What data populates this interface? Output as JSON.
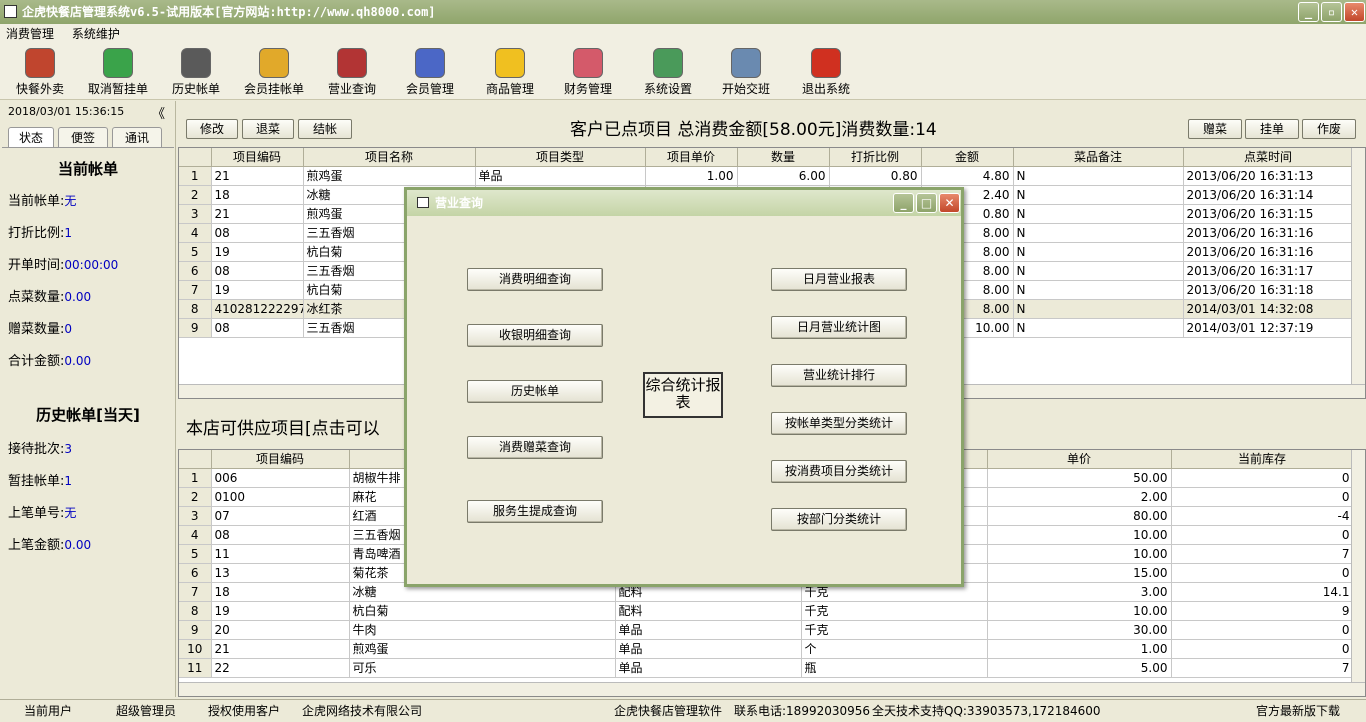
{
  "window": {
    "title": "企虎快餐店管理系统v6.5-试用版本[官方网站:http://www.qh8000.com]"
  },
  "menu": [
    "消费管理",
    "系统维护"
  ],
  "toolbar": [
    {
      "label": "快餐外卖",
      "icon": "takeout-icon",
      "color": "#c0452e"
    },
    {
      "label": "取消暂挂单",
      "icon": "cancel-hold-icon",
      "color": "#3aa34a"
    },
    {
      "label": "历史帐单",
      "icon": "alarm-clock-icon",
      "color": "#5a5a5a"
    },
    {
      "label": "会员挂帐单",
      "icon": "coins-arrow-icon",
      "color": "#e1a92a"
    },
    {
      "label": "营业查询",
      "icon": "report-icon",
      "color": "#b23434"
    },
    {
      "label": "会员管理",
      "icon": "member-face-icon",
      "color": "#4b67c6"
    },
    {
      "label": "商品管理",
      "icon": "star-icon",
      "color": "#f0c020"
    },
    {
      "label": "财务管理",
      "icon": "calculator-icon",
      "color": "#d45a6a"
    },
    {
      "label": "系统设置",
      "icon": "settings-icon",
      "color": "#4a9a5a"
    },
    {
      "label": "开始交班",
      "icon": "handshake-icon",
      "color": "#6a8ab0"
    },
    {
      "label": "退出系统",
      "icon": "power-icon",
      "color": "#d03020"
    }
  ],
  "left": {
    "datetime": "2018/03/01 15:36:15",
    "collapse": "《",
    "tabs": [
      "状态",
      "便签",
      "通讯"
    ],
    "current_title": "当前帐单",
    "current_fields": [
      {
        "label": "当前帐单:",
        "value": "无"
      },
      {
        "label": "打折比例:",
        "value": "1"
      },
      {
        "label": "开单时间:",
        "value": "00:00:00"
      },
      {
        "label": "点菜数量:",
        "value": "0.00"
      },
      {
        "label": "赠菜数量:",
        "value": "0"
      },
      {
        "label": "合计金额:",
        "value": "0.00"
      }
    ],
    "history_title": "历史帐单[当天]",
    "history_fields": [
      {
        "label": "接待批次:",
        "value": "3"
      },
      {
        "label": "暂挂帐单:",
        "value": "1"
      },
      {
        "label": "上笔单号:",
        "value": "无"
      },
      {
        "label": "上笔金额:",
        "value": "0.00"
      }
    ]
  },
  "order_buttons": {
    "left": [
      "修改",
      "退菜",
      "结帐"
    ],
    "right": [
      "赠菜",
      "挂单",
      "作废"
    ]
  },
  "summary": "客户已点项目  总消费金额[58.00元]消费数量:14",
  "order_table": {
    "headers": [
      "项目编码",
      "项目名称",
      "项目类型",
      "项目单价",
      "数量",
      "打折比例",
      "金额",
      "菜品备注",
      "点菜时间"
    ],
    "rows": [
      [
        "1",
        "21",
        "煎鸡蛋",
        "单品",
        "1.00",
        "6.00",
        "0.80",
        "4.80",
        "N",
        "2013/06/20 16:31:13"
      ],
      [
        "2",
        "18",
        "冰糖",
        "",
        "",
        "",
        "",
        "2.40",
        "N",
        "2013/06/20 16:31:14"
      ],
      [
        "3",
        "21",
        "煎鸡蛋",
        "",
        "",
        "",
        "",
        "0.80",
        "N",
        "2013/06/20 16:31:15"
      ],
      [
        "4",
        "08",
        "三五香烟",
        "",
        "",
        "",
        "",
        "8.00",
        "N",
        "2013/06/20 16:31:16"
      ],
      [
        "5",
        "19",
        "杭白菊",
        "",
        "",
        "",
        "",
        "8.00",
        "N",
        "2013/06/20 16:31:16"
      ],
      [
        "6",
        "08",
        "三五香烟",
        "",
        "",
        "",
        "",
        "8.00",
        "N",
        "2013/06/20 16:31:17"
      ],
      [
        "7",
        "19",
        "杭白菊",
        "",
        "",
        "",
        "",
        "8.00",
        "N",
        "2013/06/20 16:31:18"
      ],
      [
        "8",
        "41028122229​75",
        "冰红茶",
        "",
        "",
        "",
        "",
        "8.00",
        "N",
        "2014/03/01 14:32:08"
      ],
      [
        "9",
        "08",
        "三五香烟",
        "",
        "",
        "",
        "",
        "10.00",
        "N",
        "2014/03/01 12:37:19"
      ]
    ]
  },
  "supply_title": "本店可供应项目[点击可以",
  "supply_table": {
    "headers": [
      "项目编码",
      "",
      "",
      "",
      "单价",
      "当前库存"
    ],
    "rows": [
      [
        "1",
        "006",
        "胡椒牛排",
        "",
        "",
        "50.00",
        "0"
      ],
      [
        "2",
        "0100",
        "麻花",
        "",
        "",
        "2.00",
        "0"
      ],
      [
        "3",
        "07",
        "红酒",
        "",
        "",
        "80.00",
        "-4"
      ],
      [
        "4",
        "08",
        "三五香烟",
        "",
        "",
        "10.00",
        "0"
      ],
      [
        "5",
        "11",
        "青岛啤酒",
        "",
        "",
        "10.00",
        "7"
      ],
      [
        "6",
        "13",
        "菊花茶",
        "",
        "",
        "15.00",
        "0"
      ],
      [
        "7",
        "18",
        "冰糖",
        "配料",
        "千克",
        "3.00",
        "14.1"
      ],
      [
        "8",
        "19",
        "杭白菊",
        "配料",
        "千克",
        "10.00",
        "9"
      ],
      [
        "9",
        "20",
        "牛肉",
        "单品",
        "千克",
        "30.00",
        "0"
      ],
      [
        "10",
        "21",
        "煎鸡蛋",
        "单品",
        "个",
        "1.00",
        "0"
      ],
      [
        "11",
        "22",
        "可乐",
        "单品",
        "瓶",
        "5.00",
        "7"
      ]
    ]
  },
  "dialog": {
    "title": "营业查询",
    "left_buttons": [
      "消费明细查询",
      "收银明细查询",
      "历史帐单",
      "消费赠菜查询",
      "服务生提成查询"
    ],
    "center_button": "综合统计报表",
    "right_buttons": [
      "日月营业报表",
      "日月营业统计图",
      "营业统计排行",
      "按帐单类型分类统计",
      "按消费项目分类统计",
      "按部门分类统计"
    ]
  },
  "status": [
    "当前用户",
    "超级管理员",
    "授权使用客户",
    "企虎网络技术有限公司",
    "企虎快餐店管理软件",
    "联系电话:18992030956",
    "全天技术支持QQ:33903573,172184600",
    "官方最新版下载"
  ]
}
